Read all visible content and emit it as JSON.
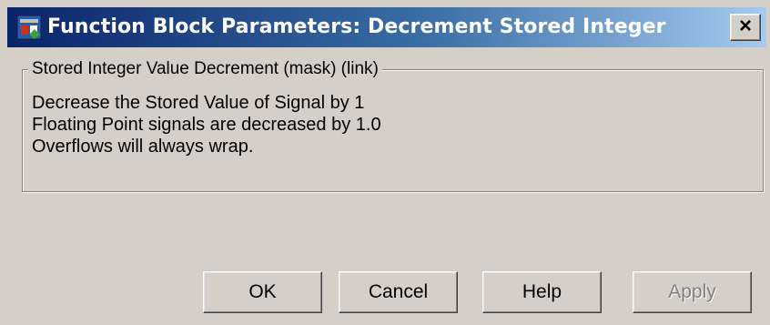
{
  "window": {
    "title": "Function Block Parameters: Decrement Stored Integer",
    "icon": "simulink-block-icon",
    "close_label": "×"
  },
  "group": {
    "legend": "Stored Integer Value Decrement (mask) (link)",
    "lines": [
      "Decrease the Stored Value of Signal by 1",
      "Floating Point signals are decreased by 1.0",
      "Overflows will always wrap."
    ]
  },
  "buttons": {
    "ok": "OK",
    "cancel": "Cancel",
    "help": "Help",
    "apply": "Apply"
  },
  "colors": {
    "titlebar_start": "#0a246a",
    "titlebar_end": "#a6caf0",
    "face": "#d4d0c8"
  }
}
